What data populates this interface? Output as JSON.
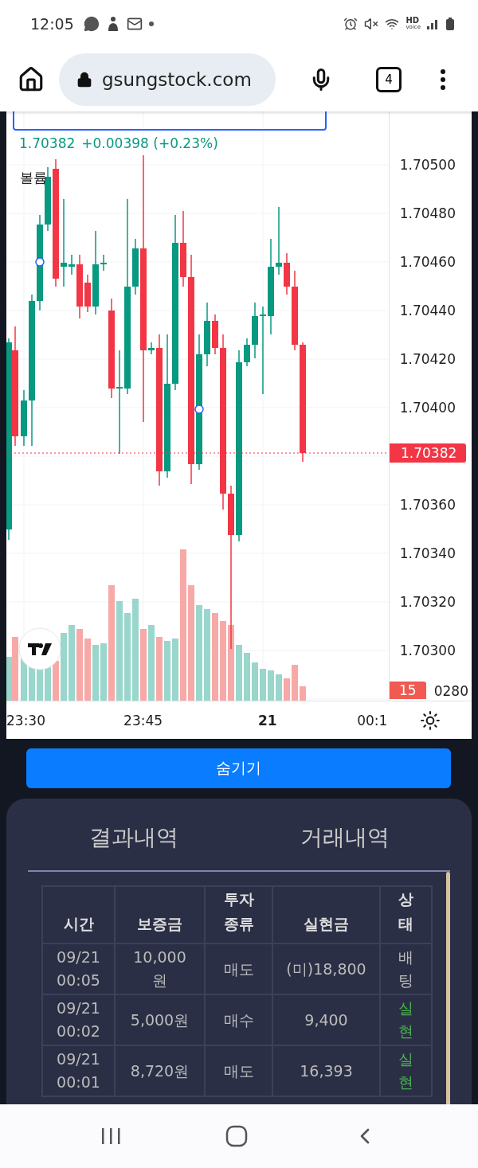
{
  "status_bar": {
    "time": "12:05",
    "network_label": "HD",
    "network_sublabel": "voice"
  },
  "browser": {
    "url": "gsungstock.com",
    "tab_count": "4"
  },
  "chart": {
    "price": "1.70382",
    "change": "+0.00398 (+0.23%)",
    "volume_label": "볼륨",
    "y_ticks": [
      "1.70500",
      "1.70480",
      "1.70460",
      "1.70440",
      "1.70420",
      "1.70400",
      "1.70360",
      "1.70340",
      "1.70320",
      "1.70300"
    ],
    "last_price": "1.70382",
    "volume_badge": "15",
    "cut_tick": "0280",
    "x_ticks": [
      {
        "label": "23:30",
        "kind": "time"
      },
      {
        "label": "23:45",
        "kind": "time"
      },
      {
        "label": "21",
        "kind": "day"
      },
      {
        "label": "00:1",
        "kind": "time"
      }
    ]
  },
  "hide_button": "숨기기",
  "tabs": [
    {
      "label": "결과내역"
    },
    {
      "label": "거래내역"
    }
  ],
  "table": {
    "columns": [
      "시간",
      "보증금",
      "투자 종류",
      "실현금",
      "상태"
    ],
    "rows": [
      {
        "time": "09/21 00:05",
        "deposit": "10,000원",
        "type": "매도",
        "realized": "(미)18,800",
        "status": "배팅",
        "kind": "pending"
      },
      {
        "time": "09/21 00:02",
        "deposit": "5,000원",
        "type": "매수",
        "realized": "9,400",
        "status": "실현",
        "kind": "done"
      },
      {
        "time": "09/21 00:01",
        "deposit": "8,720원",
        "type": "매도",
        "realized": "16,393",
        "status": "실현",
        "kind": "done"
      }
    ]
  }
}
